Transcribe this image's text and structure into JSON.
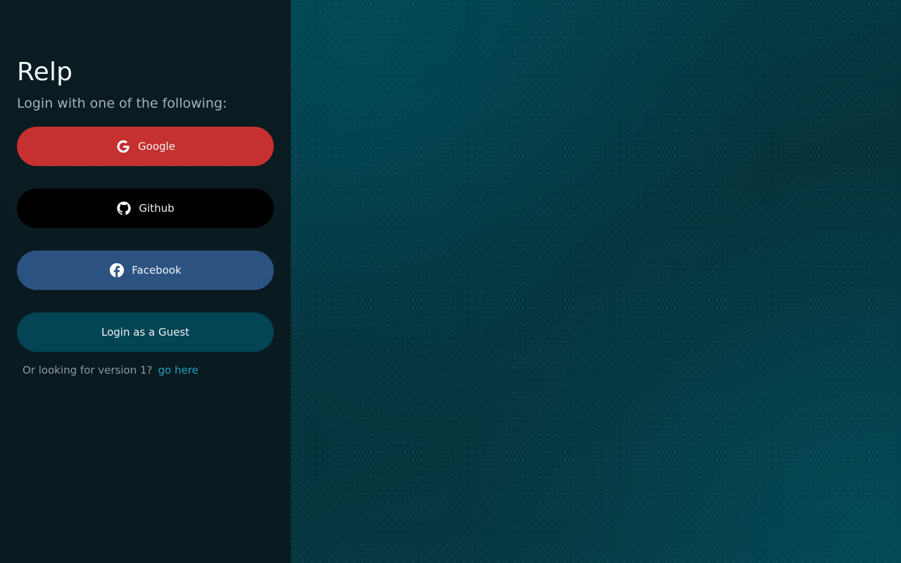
{
  "app": {
    "title": "Relp",
    "subtitle": "Login with one of the following:"
  },
  "buttons": {
    "google": {
      "label": "Google",
      "icon": "google-icon",
      "color": "#c53030"
    },
    "github": {
      "label": "Github",
      "icon": "github-icon",
      "color": "#000000"
    },
    "facebook": {
      "label": "Facebook",
      "icon": "facebook-icon",
      "color": "#2c5282"
    },
    "guest": {
      "label": "Login as a Guest",
      "color": "#034455"
    }
  },
  "version": {
    "prompt": "Or looking for version 1?",
    "link_label": "go here",
    "link_color": "#1fa3c2"
  },
  "colors": {
    "sidebar_bg": "#0b1b22",
    "backdrop_bg": "#06323b"
  }
}
